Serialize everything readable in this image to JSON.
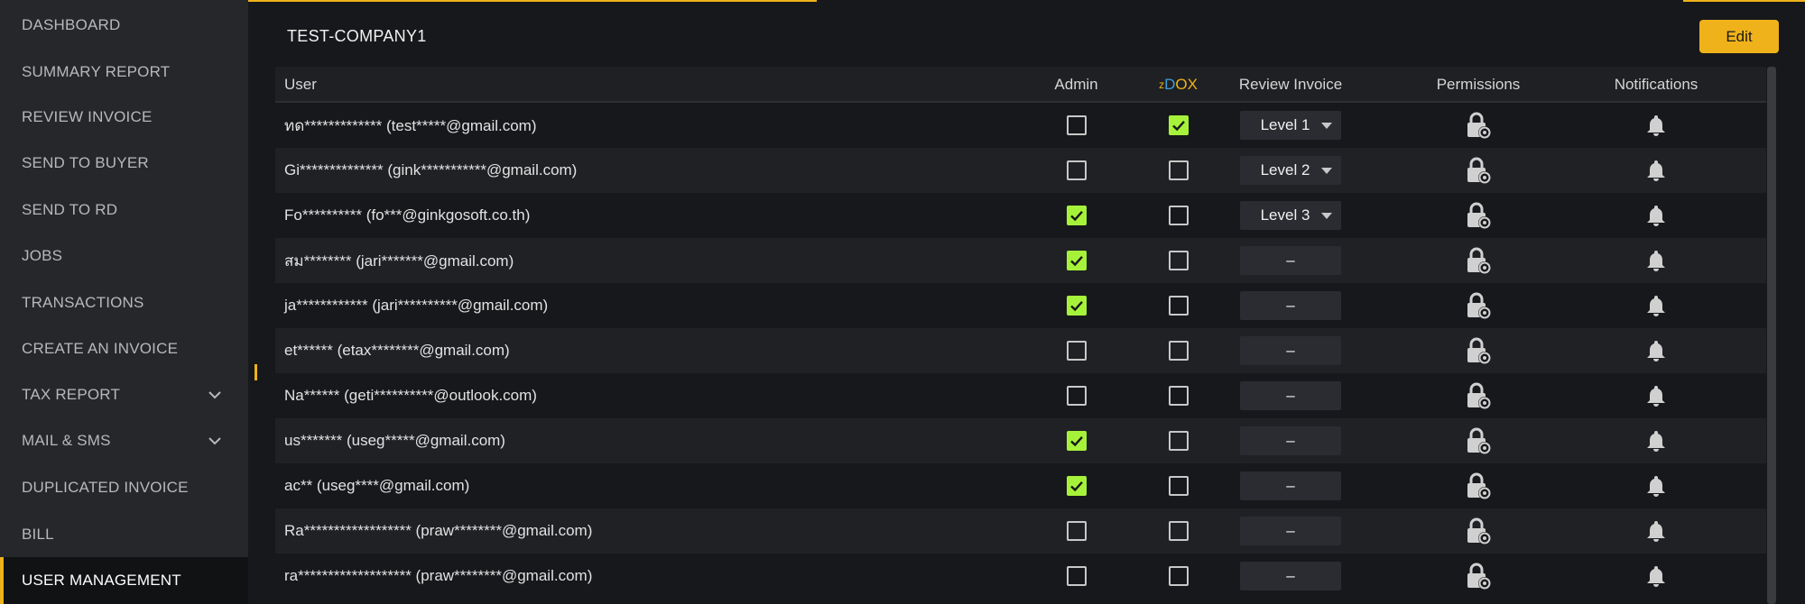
{
  "sidebar": {
    "items": [
      {
        "label": "DASHBOARD",
        "expandable": false,
        "active": false
      },
      {
        "label": "SUMMARY REPORT",
        "expandable": false,
        "active": false
      },
      {
        "label": "REVIEW INVOICE",
        "expandable": false,
        "active": false
      },
      {
        "label": "SEND TO BUYER",
        "expandable": false,
        "active": false
      },
      {
        "label": "SEND TO RD",
        "expandable": false,
        "active": false
      },
      {
        "label": "JOBS",
        "expandable": false,
        "active": false
      },
      {
        "label": "TRANSACTIONS",
        "expandable": false,
        "active": false
      },
      {
        "label": "CREATE AN INVOICE",
        "expandable": false,
        "active": false
      },
      {
        "label": "TAX REPORT",
        "expandable": true,
        "active": false
      },
      {
        "label": "MAIL & SMS",
        "expandable": true,
        "active": false
      },
      {
        "label": "DUPLICATED INVOICE",
        "expandable": false,
        "active": false
      },
      {
        "label": "BILL",
        "expandable": false,
        "active": false
      },
      {
        "label": "USER MANAGEMENT",
        "expandable": false,
        "active": true
      }
    ]
  },
  "header": {
    "company": "TEST-COMPANY1",
    "edit_label": "Edit"
  },
  "table": {
    "columns": {
      "user": "User",
      "admin": "Admin",
      "zdox_z": "z",
      "zdox_d": "D",
      "zdox_ox": "OX",
      "review_invoice": "Review Invoice",
      "permissions": "Permissions",
      "notifications": "Notifications"
    },
    "rows": [
      {
        "user": "ทด************* (test*****@gmail.com)",
        "admin": false,
        "zdox": true,
        "review": "Level 1",
        "has_level": true
      },
      {
        "user": "Gi************** (gink***********@gmail.com)",
        "admin": false,
        "zdox": false,
        "review": "Level 2",
        "has_level": true
      },
      {
        "user": "Fo********** (fo***@ginkgosoft.co.th)",
        "admin": true,
        "zdox": false,
        "review": "Level 3",
        "has_level": true
      },
      {
        "user": "สม******** (jari*******@gmail.com)",
        "admin": true,
        "zdox": false,
        "review": "–",
        "has_level": false
      },
      {
        "user": "ja************ (jari**********@gmail.com)",
        "admin": true,
        "zdox": false,
        "review": "–",
        "has_level": false
      },
      {
        "user": "et****** (etax********@gmail.com)",
        "admin": false,
        "zdox": false,
        "review": "–",
        "has_level": false
      },
      {
        "user": "Na****** (geti**********@outlook.com)",
        "admin": false,
        "zdox": false,
        "review": "–",
        "has_level": false
      },
      {
        "user": "us******* (useg*****@gmail.com)",
        "admin": true,
        "zdox": false,
        "review": "–",
        "has_level": false
      },
      {
        "user": "ac** (useg****@gmail.com)",
        "admin": true,
        "zdox": false,
        "review": "–",
        "has_level": false
      },
      {
        "user": "Ra****************** (praw********@gmail.com)",
        "admin": false,
        "zdox": false,
        "review": "–",
        "has_level": false
      },
      {
        "user": "ra******************* (praw********@gmail.com)",
        "admin": false,
        "zdox": false,
        "review": "–",
        "has_level": false
      }
    ]
  },
  "icons": {
    "permissions": "lock-gear-icon",
    "notifications": "bell-icon",
    "expand": "chevron-down-icon",
    "check": "checkmark-icon"
  },
  "colors": {
    "accent": "#f0b21a",
    "check": "#a6f23a",
    "zdox_blue": "#3aa0e0"
  }
}
